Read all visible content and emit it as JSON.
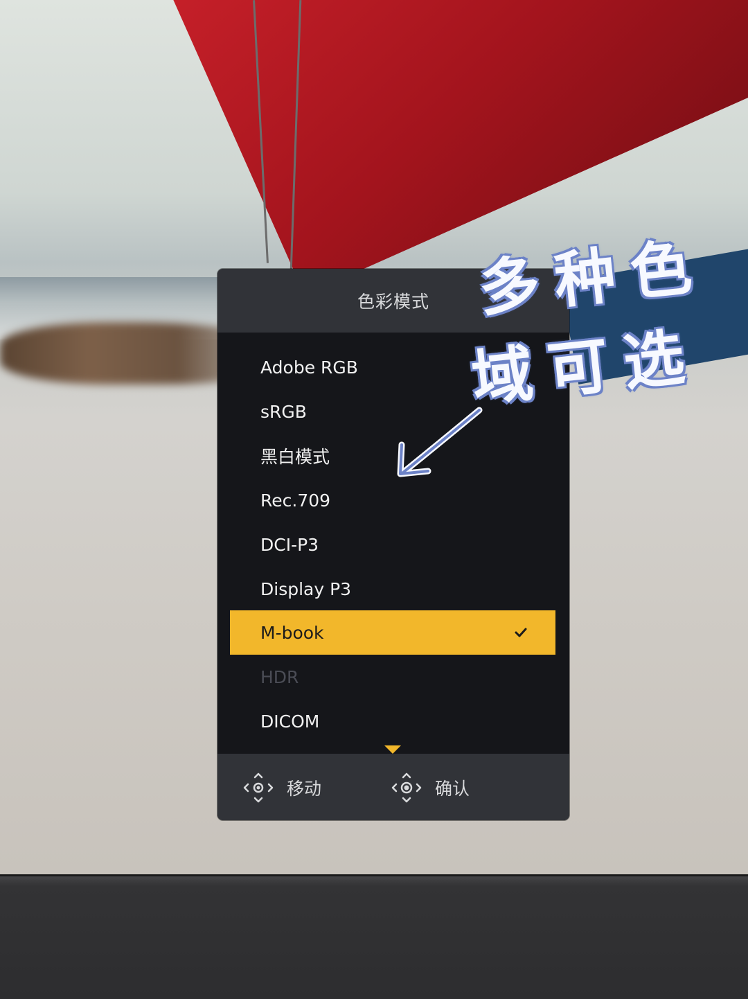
{
  "osd": {
    "title": "色彩模式",
    "items": [
      {
        "label": "Adobe RGB",
        "state": "normal"
      },
      {
        "label": "sRGB",
        "state": "normal"
      },
      {
        "label": "黑白模式",
        "state": "normal"
      },
      {
        "label": "Rec.709",
        "state": "normal"
      },
      {
        "label": "DCI-P3",
        "state": "normal"
      },
      {
        "label": "Display P3",
        "state": "normal"
      },
      {
        "label": "M-book",
        "state": "selected"
      },
      {
        "label": "HDR",
        "state": "disabled"
      },
      {
        "label": "DICOM",
        "state": "normal"
      }
    ],
    "footer": {
      "move_label": "移动",
      "confirm_label": "确认"
    }
  },
  "overlay": {
    "line1": "多种色",
    "line2": "域可选"
  },
  "colors": {
    "accent": "#f2b72b",
    "panel": "#15161a",
    "header": "#313338",
    "disabled_text": "#4a4c55",
    "overlay_outline": "#6c82c7"
  },
  "icons": {
    "selected_marker": "checkmark-icon",
    "move": "joystick-move-icon",
    "confirm": "joystick-press-icon",
    "more": "scroll-down-arrow-icon"
  }
}
